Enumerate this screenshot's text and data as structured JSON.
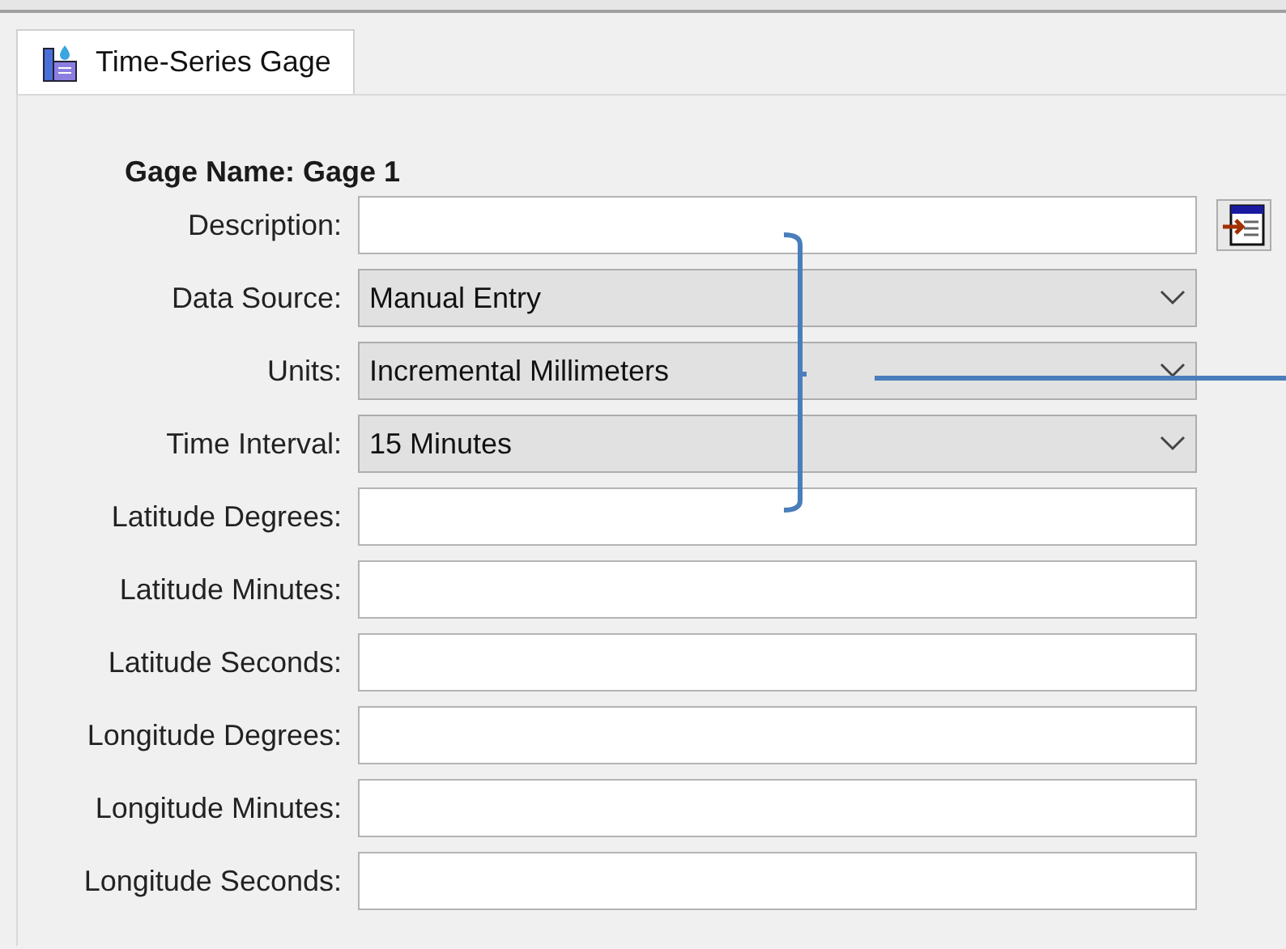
{
  "tabs": [
    {
      "label": "Time-Series Gage",
      "selected": true
    }
  ],
  "gage_name": "Gage Name: Gage 1",
  "fields": [
    {
      "label": "Description:",
      "kind": "text",
      "has_editor_button": true
    },
    {
      "label": "Data Source:",
      "kind": "select",
      "value": "Manual Entry"
    },
    {
      "label": "Units:",
      "kind": "select",
      "value": "Incremental Millimeters"
    },
    {
      "label": "Time Interval:",
      "kind": "select",
      "value": "15 Minutes"
    },
    {
      "label": "Latitude Degrees:",
      "kind": "text"
    },
    {
      "label": "Latitude Minutes:",
      "kind": "text"
    },
    {
      "label": "Latitude Seconds:",
      "kind": "text"
    },
    {
      "label": "Longitude Degrees:",
      "kind": "text"
    },
    {
      "label": "Longitude Minutes:",
      "kind": "text"
    },
    {
      "label": "Longitude Seconds:",
      "kind": "text"
    }
  ]
}
